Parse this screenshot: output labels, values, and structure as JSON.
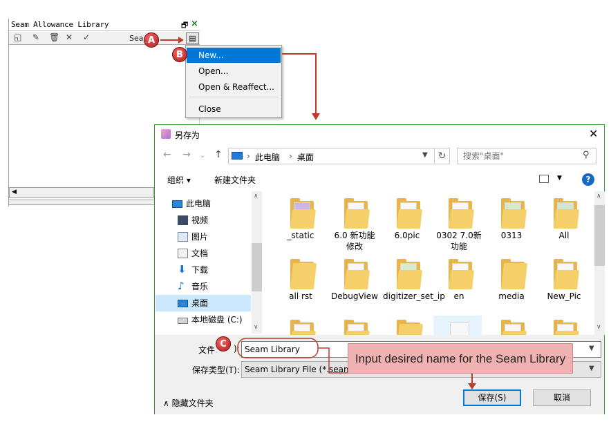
{
  "library_panel": {
    "title": "Seam Allowance Library",
    "pin_icon": "pin-restore-icon",
    "close_icon": "close-icon",
    "toolbar_icons": [
      "new-icon",
      "edit-icon",
      "delete-icon",
      "cancel-icon",
      "confirm-icon"
    ],
    "search_label": "Sea",
    "menu_icon": "document-menu-icon"
  },
  "context_menu": {
    "items": [
      {
        "label": "New...",
        "mnemonic": "N"
      },
      {
        "label": "Open...",
        "mnemonic": "O"
      },
      {
        "label": "Open & Reaffect...",
        "mnemonic": "R"
      },
      {
        "label": "Close",
        "mnemonic": "C"
      }
    ]
  },
  "dialog": {
    "title": "另存为",
    "breadcrumb": [
      "此电脑",
      "桌面"
    ],
    "search_placeholder": "搜索\"桌面\"",
    "organize_label": "组织 ▾",
    "new_folder_label": "新建文件夹",
    "nav_items": [
      {
        "label": "此电脑",
        "icon": "computer-icon"
      },
      {
        "label": "视频",
        "icon": "video-icon"
      },
      {
        "label": "图片",
        "icon": "picture-icon"
      },
      {
        "label": "文档",
        "icon": "document-icon"
      },
      {
        "label": "下载",
        "icon": "download-icon"
      },
      {
        "label": "音乐",
        "icon": "music-icon"
      },
      {
        "label": "桌面",
        "icon": "desktop-icon"
      },
      {
        "label": "本地磁盘 (C:)",
        "icon": "drive-icon"
      }
    ],
    "files_row1": [
      "_static",
      "6.0 新功能修改",
      "6.0pic",
      "0302 7.0新功能",
      "0313",
      "All"
    ],
    "files_row2": [
      "all rst",
      "DebugView",
      "digitizer_set_ip",
      "en",
      "media",
      "New_Pic"
    ],
    "filename_label": "文件",
    "filename_value": "Seam Library",
    "filetype_label": "保存类型(T):",
    "filetype_value": "Seam Library File (*.seam)",
    "hide_folders_label": "隐藏文件夹",
    "save_label": "保存(S)",
    "cancel_label": "取消"
  },
  "annotations": {
    "badges": [
      "A",
      "B",
      "C"
    ],
    "callout": "Input desired name for the Seam Library",
    "accent_color": "#c0392b"
  }
}
